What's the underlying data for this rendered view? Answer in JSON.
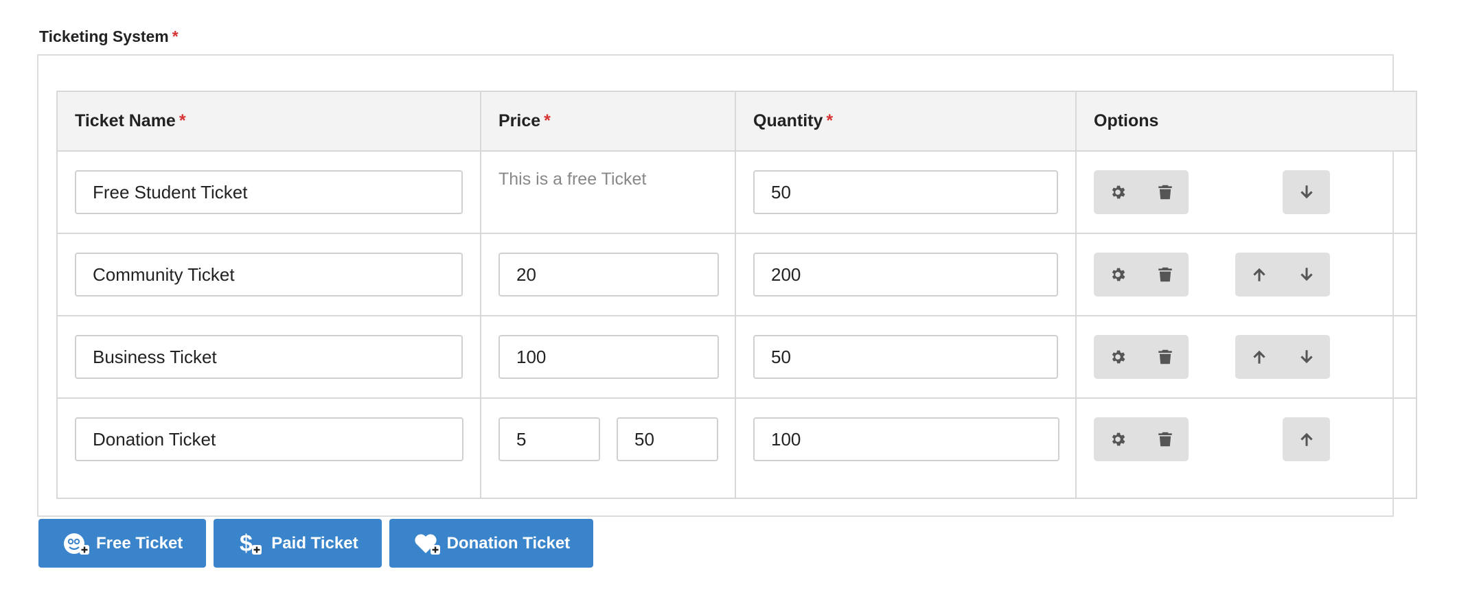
{
  "section": {
    "label": "Ticketing System",
    "required_mark": "*"
  },
  "table": {
    "headers": {
      "name": "Ticket Name",
      "price": "Price",
      "quantity": "Quantity",
      "options": "Options"
    },
    "required_mark": "*",
    "rows": [
      {
        "name": "Free Student Ticket",
        "price_note": "This is a free Ticket",
        "quantity": "50"
      },
      {
        "name": "Community Ticket",
        "price": "20",
        "quantity": "200"
      },
      {
        "name": "Business Ticket",
        "price": "100",
        "quantity": "50"
      },
      {
        "name": "Donation Ticket",
        "price_min": "5",
        "price_max": "50",
        "quantity": "100"
      }
    ]
  },
  "actions": {
    "free_ticket": "Free Ticket",
    "paid_ticket": "Paid Ticket",
    "donation_ticket": "Donation Ticket"
  },
  "colors": {
    "primary_button": "#3a84cc",
    "required": "#d63333",
    "icon_button_bg": "#e0e0e0",
    "header_bg": "#f3f3f3"
  },
  "icons": {
    "settings": "gear-icon",
    "delete": "trash-icon",
    "move_up": "arrow-up-icon",
    "move_down": "arrow-down-icon",
    "free": "smiley-plus-icon",
    "paid": "dollar-plus-icon",
    "donation": "heart-plus-icon"
  }
}
